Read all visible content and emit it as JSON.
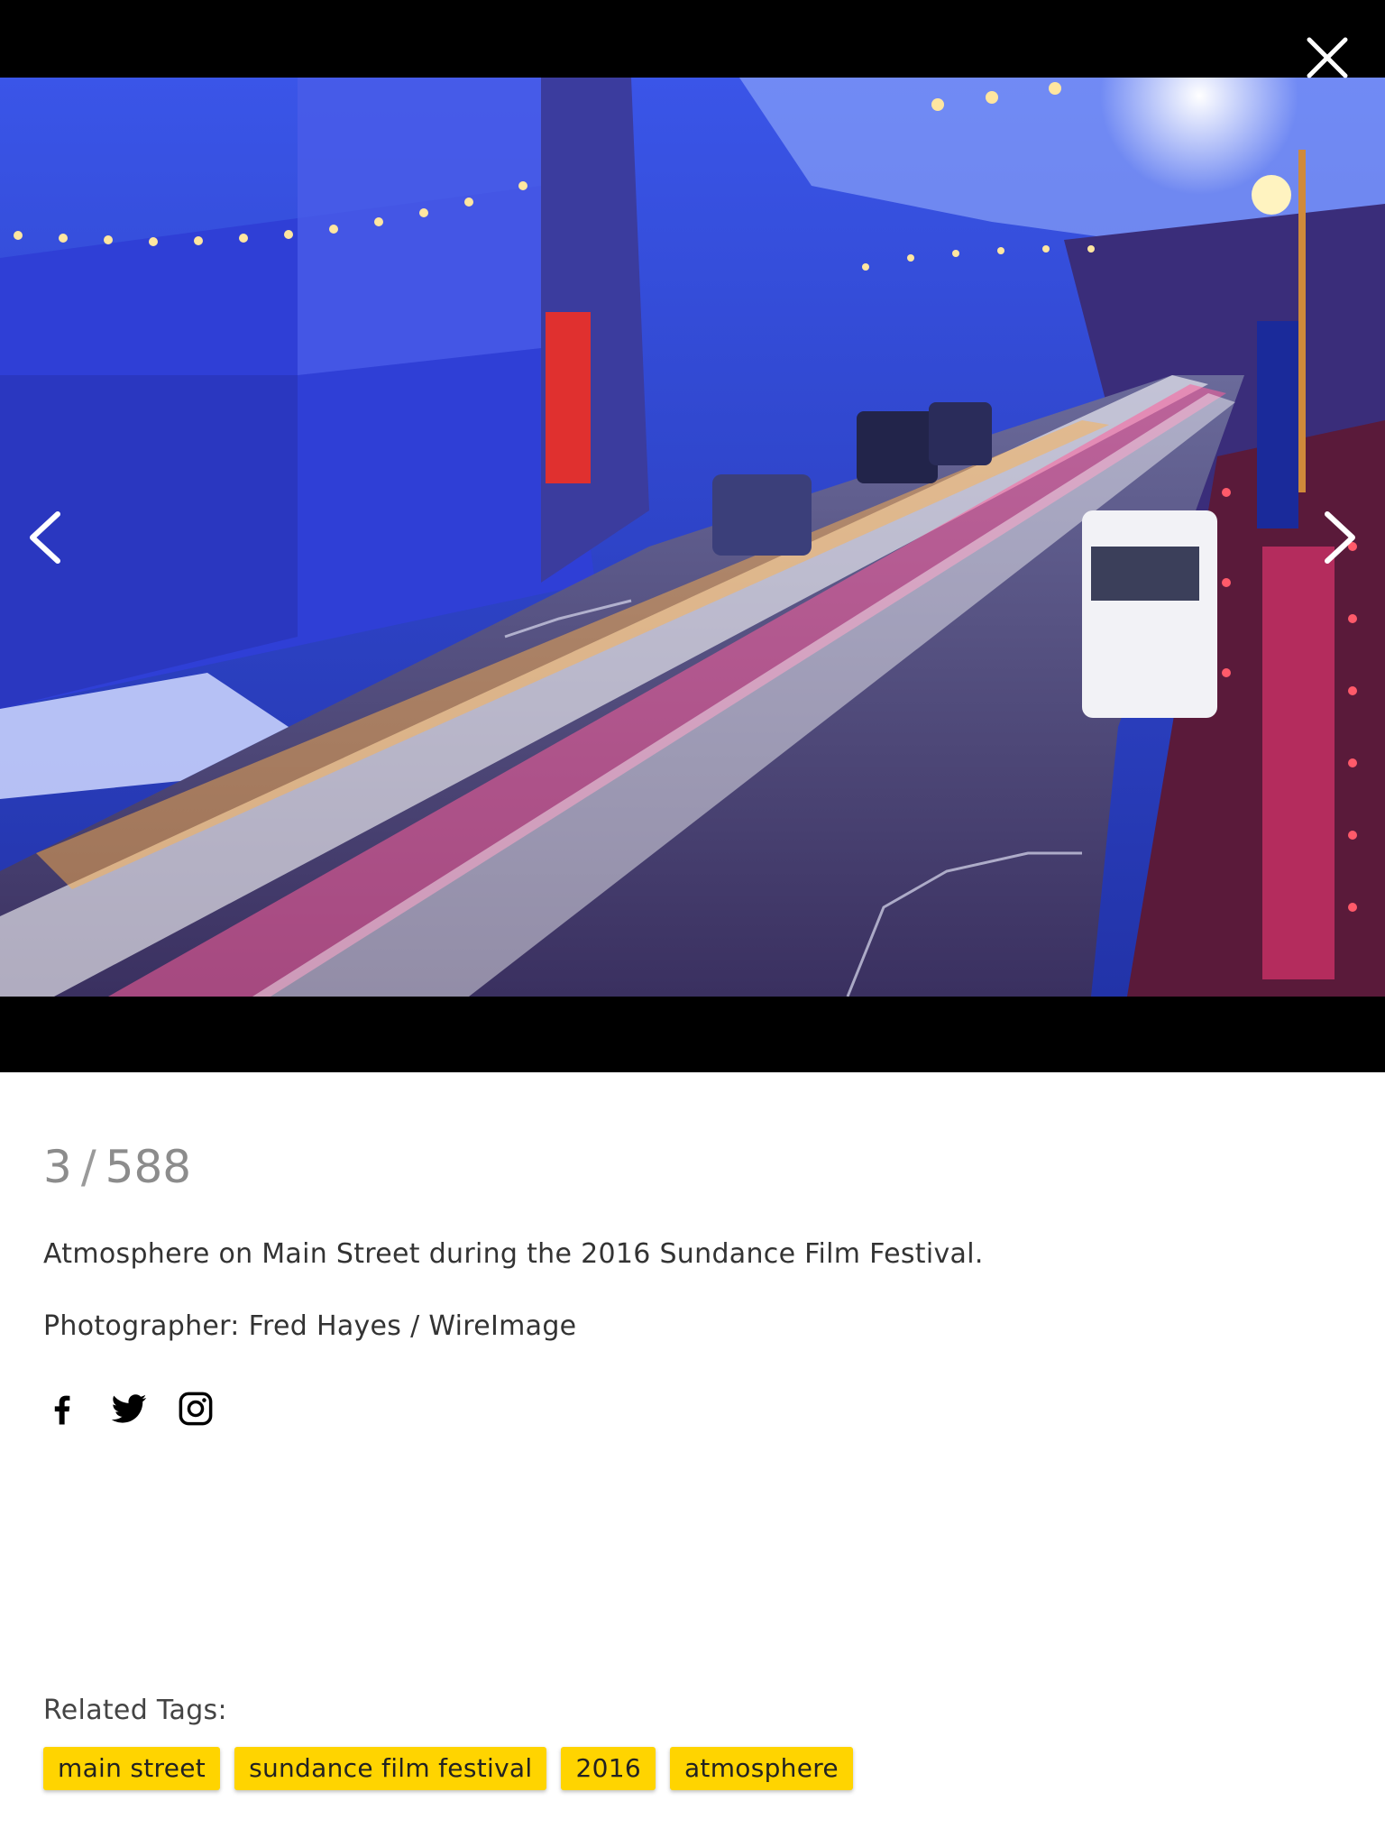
{
  "viewer": {
    "photo_alt": "Atmosphere on Main Street during the 2016 Sundance Film Festival.",
    "close_icon": "close-icon",
    "prev_icon": "chevron-left-icon",
    "next_icon": "chevron-right-icon",
    "icon_color": "#ffffff",
    "background_color": "#000000"
  },
  "details": {
    "counter": {
      "current": "3",
      "separator": "/",
      "total": "588"
    },
    "caption": "Atmosphere on Main Street during the 2016 Sundance Film Festival.",
    "credit": {
      "label": "Photographer:",
      "name": "Fred Hayes / WireImage"
    },
    "social": [
      {
        "icon": "facebook-icon"
      },
      {
        "icon": "twitter-icon"
      },
      {
        "icon": "instagram-icon"
      }
    ],
    "related_tags": {
      "label": "Related Tags:",
      "tags": [
        "main street",
        "sundance film festival",
        "2016",
        "atmosphere"
      ],
      "tag_color": "#ffd400"
    }
  }
}
